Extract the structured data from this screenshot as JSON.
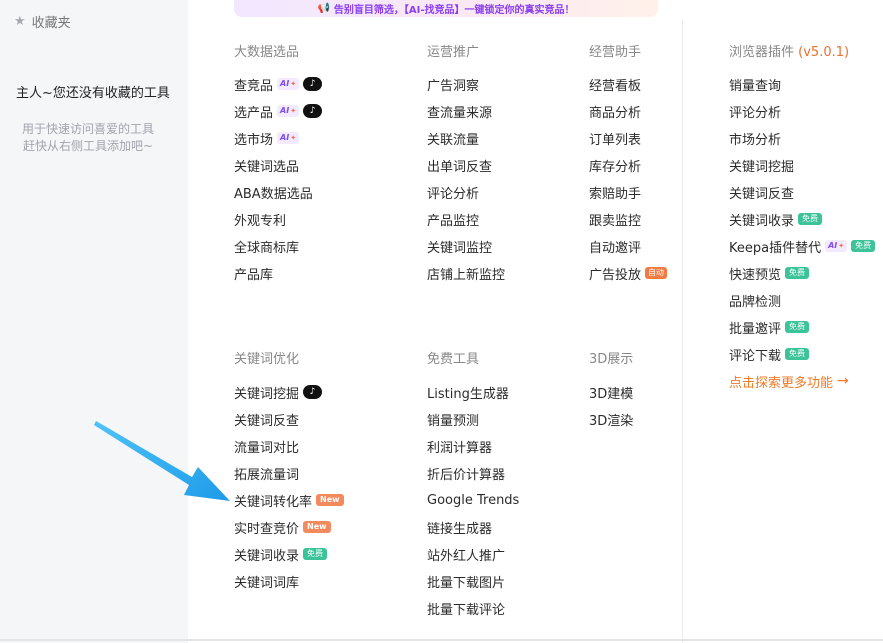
{
  "sidebar": {
    "title": "收藏夹",
    "empty_text": "主人~您还没有收藏的工具",
    "hint_line1": "用于快速访问喜爱的工具",
    "hint_line2": "赶快从右侧工具添加吧~"
  },
  "banner": {
    "icon": "megaphone-icon",
    "text": "告别盲目筛选，【AI-找竞品】一键锁定你的真实竞品！"
  },
  "badges": {
    "ai": "AI",
    "tiktok": "♪",
    "free": "免费",
    "new": "New",
    "auto": "自动"
  },
  "columns": {
    "big_data": {
      "title": "大数据选品",
      "items": [
        "查竞品",
        "选产品",
        "选市场",
        "关键词选品",
        "ABA数据选品",
        "外观专利",
        "全球商标库",
        "产品库"
      ]
    },
    "promotion": {
      "title": "运营推广",
      "items": [
        "广告洞察",
        "查流量来源",
        "关联流量",
        "出单词反查",
        "评论分析",
        "产品监控",
        "关键词监控",
        "店铺上新监控"
      ]
    },
    "assistant": {
      "title": "经营助手",
      "items": [
        "经营看板",
        "商品分析",
        "订单列表",
        "库存分析",
        "索赔助手",
        "跟卖监控",
        "自动邀评",
        "广告投放"
      ]
    },
    "browser_plugin": {
      "title": "浏览器插件",
      "version": "(v5.0.1)",
      "items": [
        "销量查询",
        "评论分析",
        "市场分析",
        "关键词挖掘",
        "关键词反查",
        "关键词收录",
        "Keepa插件替代",
        "快速预览",
        "品牌检测",
        "批量邀评",
        "评论下载"
      ],
      "more_link": "点击探索更多功能"
    },
    "keyword_opt": {
      "title": "关键词优化",
      "items": [
        "关键词挖掘",
        "关键词反查",
        "流量词对比",
        "拓展流量词",
        "关键词转化率",
        "实时查竞价",
        "关键词收录",
        "关键词词库"
      ]
    },
    "free_tools": {
      "title": "免费工具",
      "items": [
        "Listing生成器",
        "销量预测",
        "利润计算器",
        "折后价计算器",
        "Google Trends",
        "链接生成器",
        "站外红人推广",
        "批量下载图片",
        "批量下载评论"
      ]
    },
    "display_3d": {
      "title": "3D展示",
      "items": [
        "3D建模",
        "3D渲染"
      ]
    }
  },
  "colors": {
    "accent_orange": "#f07a25",
    "free_green": "#3cc39a",
    "new_orange": "#f28a5d",
    "ai_purple": "#7d4cf5",
    "arrow_blue": "#2aa7f2"
  }
}
